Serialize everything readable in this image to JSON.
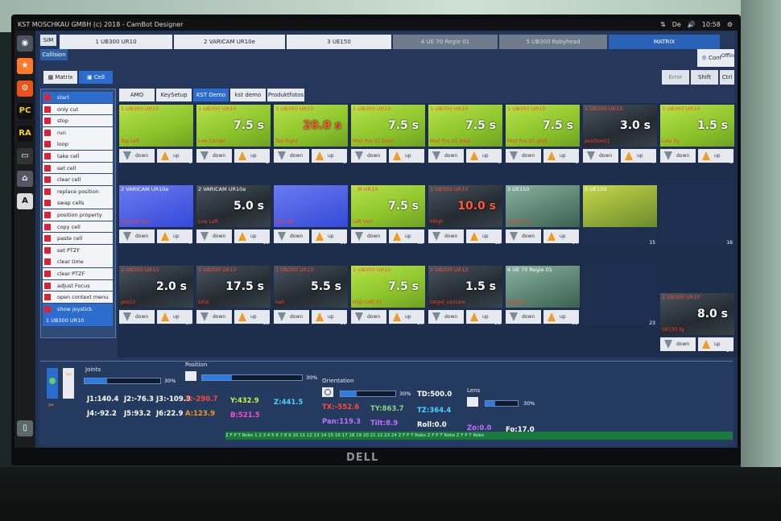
{
  "window": {
    "title": "KST MOSCHKAU GMBH (c) 2018 - CamBot Designer",
    "clock": "10:58",
    "lang": "De"
  },
  "header": {
    "sim": "SIM",
    "collision": "Collision",
    "device_tabs": [
      "1 UB300 UR10",
      "2 VARICAM UR10e",
      "3 UE150",
      "4 UE 70 Regie 01",
      "5 UB300 Robyhead",
      "MATRIX"
    ],
    "config": "Config",
    "offline": "Offline",
    "error": "Error",
    "shift": "Shift",
    "ctrl": "Ctrl"
  },
  "view_tabs": {
    "matrix": "Matrix",
    "cell": "Cell"
  },
  "mode_tabs": [
    "AMO",
    "KeySetup",
    "KST Demo",
    "kst demo day",
    "Produktfotos"
  ],
  "actions": [
    "start",
    "only cut",
    "stop",
    "run",
    "loop",
    "take cell",
    "set cell",
    "clear cell",
    "replace position",
    "swap cells",
    "position property",
    "copy cell",
    "paste cell",
    "set PTZF",
    "clear time",
    "clear PTZF",
    "adjust Focus",
    "open context menu",
    "show joystick"
  ],
  "device_select": "1 UB300 UR10",
  "cells": [
    {
      "num": "1",
      "cam": "1 UB300 UR10",
      "time": "",
      "desc": "Top Left"
    },
    {
      "num": "2",
      "cam": "1 UB300 UR10",
      "time": "7.5 s",
      "desc": "Low Center"
    },
    {
      "num": "3",
      "cam": "1 UB300 UR10",
      "time": "20.0 s",
      "desc": "Top Right"
    },
    {
      "num": "4",
      "cam": "1 UB300 UR10",
      "time": "7.5 s",
      "desc": "Mod Pos 01 klein"
    },
    {
      "num": "5",
      "cam": "1 UB300 UR10",
      "time": "7.5 s",
      "desc": "Mod Pos 01 klein"
    },
    {
      "num": "6",
      "cam": "1 UB300 UR10",
      "time": "7.5 s",
      "desc": "Mod Pos 01 groß"
    },
    {
      "num": "7",
      "cam": "1 UB300 UR10",
      "time": "3.0 s",
      "desc": "position01"
    },
    {
      "num": "8",
      "cam": "1 UB300 UR10",
      "time": "1.5 s",
      "desc": "Lola Tg"
    },
    {
      "num": "9",
      "cam": "2 VARICAM UR10e",
      "time": "",
      "desc": "Top Left Vari"
    },
    {
      "num": "10",
      "cam": "2 VARICAM UR10e",
      "time": "5.0 s",
      "desc": "Low Left"
    },
    {
      "num": "11",
      "cam": "",
      "time": "",
      "desc": "Top Left"
    },
    {
      "num": "12",
      "cam": "...M UR10",
      "time": "7.5 s",
      "desc": "Left Vari"
    },
    {
      "num": "13",
      "cam": "1 UB300 UR10",
      "time": "10.0 s",
      "desc": "Mitgh"
    },
    {
      "num": "14",
      "cam": "3 UE150",
      "time": "",
      "desc": "ue150 01"
    },
    {
      "num": "15",
      "cam": "3 UE150",
      "time": "",
      "desc": ""
    },
    {
      "num": "16",
      "cam": "",
      "time": "",
      "desc": ""
    },
    {
      "num": "17",
      "cam": "1 UB300 UR10",
      "time": "2.0 s",
      "desc": "pos10"
    },
    {
      "num": "18",
      "cam": "1 UB300 UR10",
      "time": "17.5 s",
      "desc": "total"
    },
    {
      "num": "19",
      "cam": "1 UB300 UR10",
      "time": "5.5 s",
      "desc": "nah"
    },
    {
      "num": "20",
      "cam": "1 UB300 UR10",
      "time": "7.5 s",
      "desc": "High Left 01"
    },
    {
      "num": "21",
      "cam": "1 UB300 UR10",
      "time": "1.5 s",
      "desc": "target varicam"
    },
    {
      "num": "22",
      "cam": "4 UE 70 Regie 01",
      "time": "",
      "desc": "bestenl..."
    },
    {
      "num": "23",
      "cam": "",
      "time": "",
      "desc": ""
    },
    {
      "num": "24",
      "cam": "1 UB300 UR10",
      "time": "8.0 s",
      "desc": "UE150 tg"
    }
  ],
  "cell_buttons": {
    "down": "down",
    "up": "up"
  },
  "joints": {
    "label": "Joints",
    "pct": "30%",
    "j1": "J1:140.4",
    "j2": "J2:-76.3",
    "j3": "J3:-109.8",
    "j4": "J4:-92.2",
    "j5": "J5:93.2",
    "j6": "J6:22.9"
  },
  "position": {
    "label": "Position",
    "pct": "30%",
    "x": "X:-290.7",
    "y": "Y:432.9",
    "z": "Z:441.5",
    "a": "A:123.9",
    "b": "B:521.5"
  },
  "orientation": {
    "label": "Orientation",
    "pct": "30%",
    "td": "TD:500.0",
    "tx": "TX:-552.6",
    "ty": "TY:863.7",
    "tz": "TZ:364.4",
    "pan": "Pan:119.3",
    "tilt": "Tilt:8.9",
    "roll": "Roll:0.0"
  },
  "lens": {
    "label": "Lens",
    "pct": "30%",
    "zo": "Zo:0.0",
    "fo": "Fo:17.0"
  },
  "status_strip": "Z F P T Robo  1  2  3  4  5  6  7  8  9  10  11  12  13  14  15  16  17  18  19  20  21  22  23  24  Z F P T Robo  Z F P T Robo  Z F P T Robo"
}
